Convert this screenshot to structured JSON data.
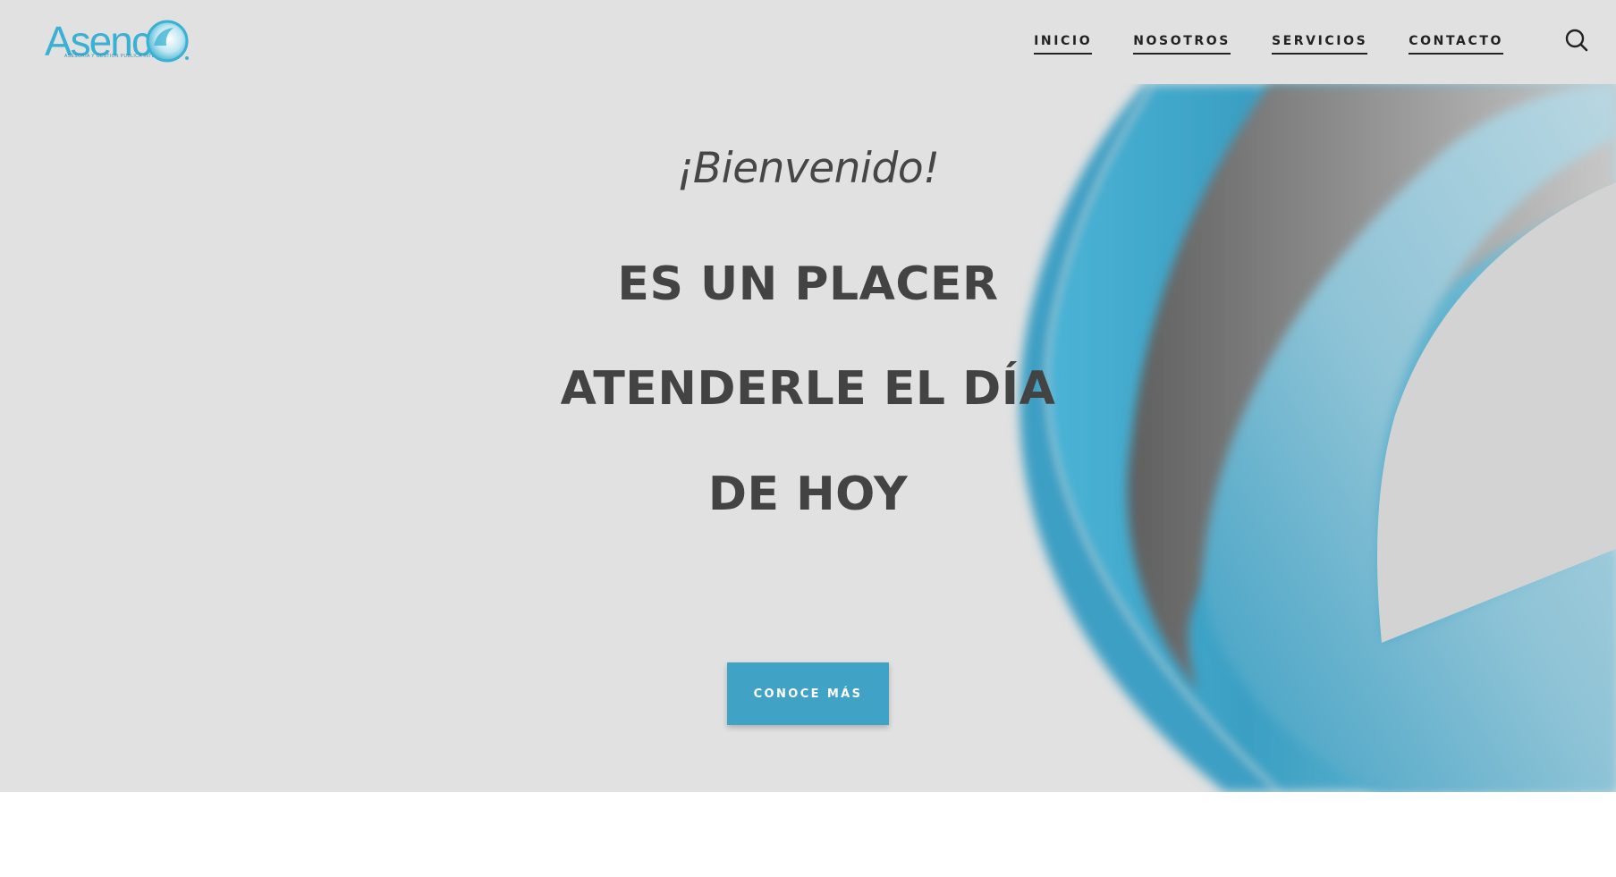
{
  "header": {
    "logo": {
      "wordmark": "Asenco",
      "tagline": "ASESORIA Y GESTION PUBLICA INTEGRAL"
    },
    "nav": [
      {
        "label": "INICIO"
      },
      {
        "label": "NOSOTROS"
      },
      {
        "label": "SERVICIOS"
      },
      {
        "label": "CONTACTO"
      }
    ],
    "search_icon": "search-icon"
  },
  "hero": {
    "greeting": "¡Bienvenido!",
    "headline": [
      "ES UN PLACER",
      "ATENDERLE EL DÍA",
      "DE HOY"
    ],
    "cta_label": "CONOCE MÁS"
  },
  "colors": {
    "brand_blue": "#40a3c6",
    "hero_background": "#e1e1e1",
    "heading_text": "#434343",
    "nav_text": "#222222"
  }
}
